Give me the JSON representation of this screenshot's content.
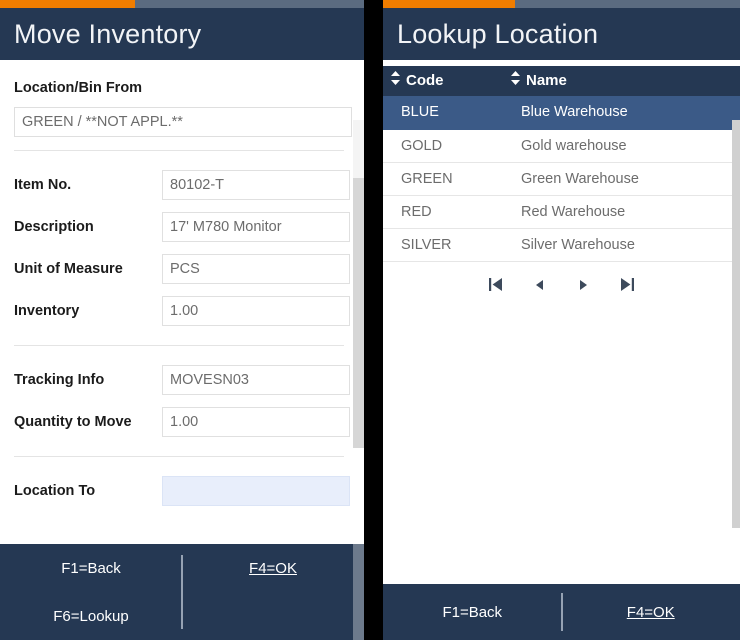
{
  "theme": {
    "header_bg": "#253853",
    "accent": "#f07d00",
    "accent_track": "#5b6b80",
    "selected_row_bg": "#3b5a87",
    "highlight_field_bg": "#e8eefb"
  },
  "left_panel": {
    "title": "Move Inventory",
    "section_label": "Location/Bin From",
    "location_from_value": "GREEN /  **NOT APPL.**",
    "fields_group_one": [
      {
        "label": "Item No.",
        "value": "80102-T"
      },
      {
        "label": "Description",
        "value": "17' M780 Monitor"
      },
      {
        "label": "Unit of Measure",
        "value": "PCS"
      },
      {
        "label": "Inventory",
        "value": "1.00"
      }
    ],
    "fields_group_two": [
      {
        "label": "Tracking Info",
        "value": "MOVESN03"
      },
      {
        "label": "Quantity to Move",
        "value": "1.00"
      }
    ],
    "fields_group_three": [
      {
        "label": "Location To",
        "value": ""
      }
    ],
    "footer": {
      "back_label": "F1=Back",
      "ok_label": "F4=OK",
      "lookup_label": "F6=Lookup"
    }
  },
  "right_panel": {
    "title": "Lookup Location",
    "table": {
      "columns": [
        {
          "label": "Code",
          "sort_icon": "sort-updown-icon"
        },
        {
          "label": "Name",
          "sort_icon": "sort-updown-icon"
        }
      ],
      "rows": [
        {
          "code": "BLUE",
          "name": "Blue Warehouse",
          "selected": true
        },
        {
          "code": "GOLD",
          "name": "Gold warehouse",
          "selected": false
        },
        {
          "code": "GREEN",
          "name": "Green Warehouse",
          "selected": false
        },
        {
          "code": "RED",
          "name": "Red Warehouse",
          "selected": false
        },
        {
          "code": "SILVER",
          "name": "Silver Warehouse",
          "selected": false
        }
      ]
    },
    "pagination": [
      {
        "name": "first-page-icon"
      },
      {
        "name": "previous-page-icon"
      },
      {
        "name": "next-page-icon"
      },
      {
        "name": "last-page-icon"
      }
    ],
    "footer": {
      "back_label": "F1=Back",
      "ok_label": "F4=OK"
    }
  }
}
